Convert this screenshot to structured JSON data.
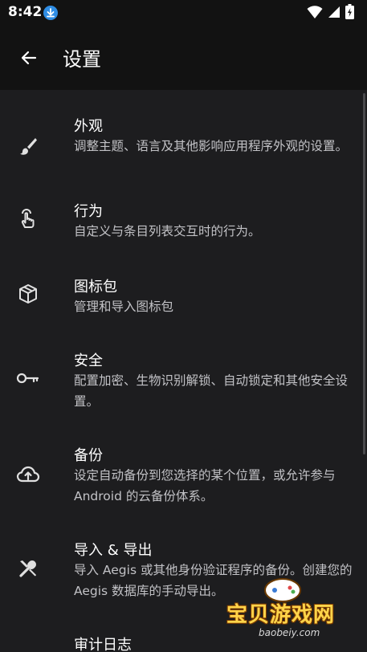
{
  "status_bar": {
    "time": "8:42"
  },
  "app_bar": {
    "title": "设置"
  },
  "items": [
    {
      "title": "外观",
      "summary": "调整主题、语言及其他影响应用程序外观的设置。",
      "icon": "brush-icon"
    },
    {
      "title": "行为",
      "summary": "自定义与条目列表交互时的行为。",
      "icon": "touch-icon"
    },
    {
      "title": "图标包",
      "summary": "管理和导入图标包",
      "icon": "package-icon"
    },
    {
      "title": "安全",
      "summary": "配置加密、生物识别解锁、自动锁定和其他安全设置。",
      "icon": "key-icon"
    },
    {
      "title": "备份",
      "summary": "设定自动备份到您选择的某个位置，或允许参与 Android 的云备份体系。",
      "icon": "cloud-upload-icon"
    },
    {
      "title": "导入 & 导出",
      "summary": "导入 Aegis 或其他身份验证程序的备份。创建您的 Aegis 数据库的手动导出。",
      "icon": "tools-icon"
    },
    {
      "title": "审计日志",
      "summary": "",
      "icon": "history-icon"
    }
  ],
  "watermark": {
    "text": "宝贝游戏网",
    "sub": "baobeiy.com"
  }
}
